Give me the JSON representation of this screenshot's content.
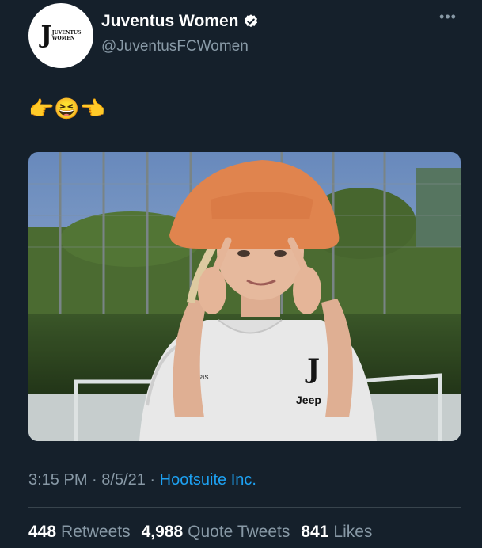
{
  "account": {
    "display_name": "Juventus Women",
    "handle": "@JuventusFCWomen",
    "verified": true,
    "avatar_wordmark_line1": "JUVENTUS",
    "avatar_wordmark_line2": "WOMEN",
    "avatar_monogram": "J"
  },
  "tweet": {
    "text": "👉😆👈",
    "time": "3:15 PM",
    "date": "8/5/21",
    "separator": " · ",
    "source": "Hootsuite Inc."
  },
  "photo": {
    "shirt_brand": "adidas",
    "shirt_sponsor": "Jeep",
    "shirt_crest": "J"
  },
  "stats": {
    "retweets_count": "448",
    "retweets_label": "Retweets",
    "quote_count": "4,988",
    "quote_label": "Quote Tweets",
    "likes_count": "841",
    "likes_label": "Likes"
  },
  "icons": {
    "verified": "verified-badge-icon",
    "more": "more-options-icon"
  },
  "colors": {
    "background": "#15202b",
    "link": "#1da1f2",
    "secondary_text": "#8899a6"
  }
}
